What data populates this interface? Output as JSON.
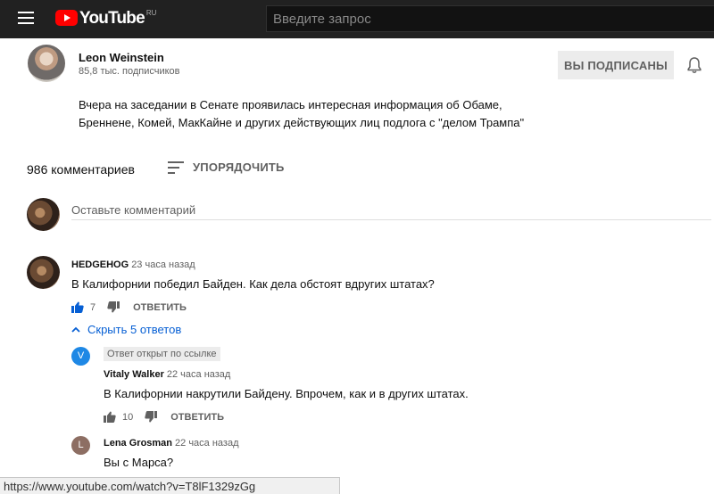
{
  "header": {
    "logo_text": "YouTube",
    "logo_region": "RU",
    "search_placeholder": "Введите запрос"
  },
  "channel": {
    "name": "Leon Weinstein",
    "subscribers": "85,8 тыс. подписчиков",
    "subscribed_label": "Вы подписаны"
  },
  "video": {
    "description": "Вчера на заседании в Сенате проявилась интересная информация об Обаме, Бреннене, Комей, МакКайне и других действующих лиц подлога с \"делом Трампа\""
  },
  "comments_header": {
    "count_label": "986 комментариев",
    "sort_label": "Упорядочить",
    "add_placeholder": "Оставьте комментарий"
  },
  "comments": [
    {
      "author": "HEDGEHOG",
      "time": "23 часа назад",
      "text": "В Калифорнии победил Байден. Как дела обстоят вдругих штатах?",
      "likes": "7",
      "reply_label": "Ответить",
      "replies_toggle": "Скрыть 5 ответов",
      "replies": [
        {
          "avatar_letter": "V",
          "avatar_color": "#1e88e5",
          "badge": "Ответ открыт по ссылке",
          "author": "Vitaly Walker",
          "time": "22 часа назад",
          "text": "В Калифорнии накрутили Байдену. Впрочем, как и в других штатах.",
          "likes": "10",
          "reply_label": "Ответить"
        },
        {
          "avatar_letter": "L",
          "avatar_color": "#8d6e63",
          "author": "Lena Grosman",
          "time": "22 часа назад",
          "text": "Вы с Марса?"
        }
      ]
    }
  ],
  "status_bar": {
    "url": "https://www.youtube.com/watch?v=T8lF1329zGg"
  },
  "colors": {
    "link_blue": "#065fd4",
    "like_active_blue": "#065fd4",
    "topbar_bg": "#212121",
    "logo_red": "#ff0000"
  }
}
